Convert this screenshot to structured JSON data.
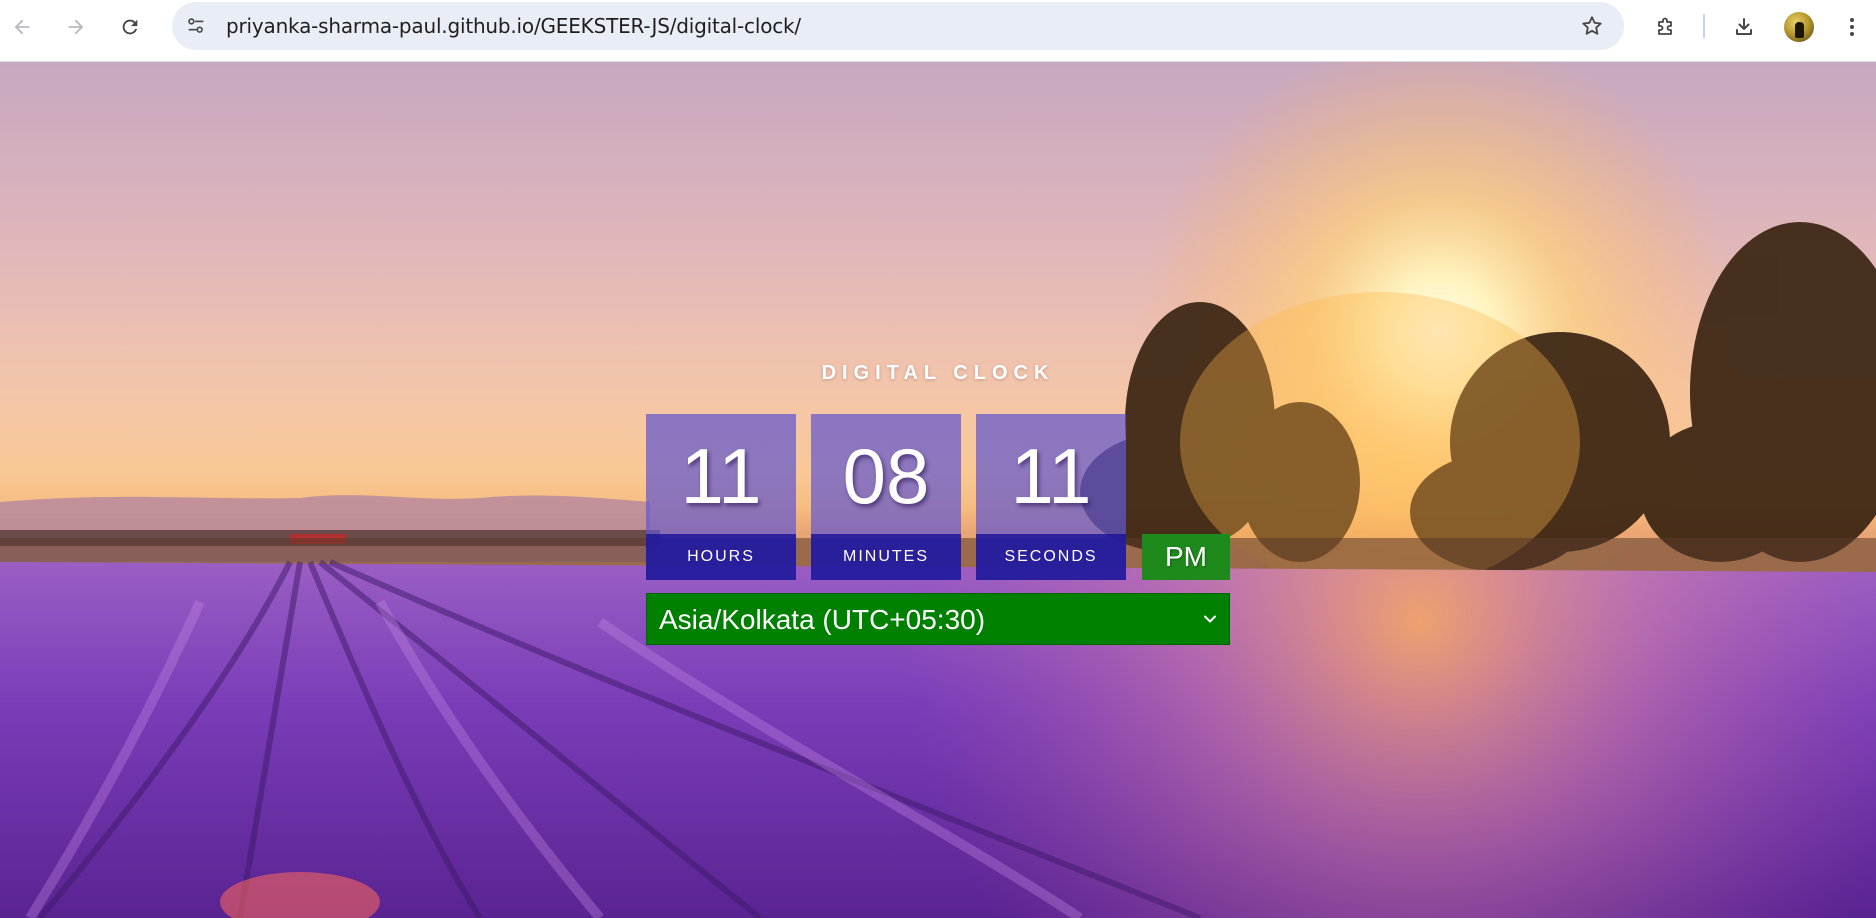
{
  "browser": {
    "url": "priyanka-sharma-paul.github.io/GEEKSTER-JS/digital-clock/",
    "icons": {
      "back": "arrow-left-icon",
      "forward": "arrow-right-icon",
      "reload": "reload-icon",
      "site_info": "tune-icon",
      "bookmark": "star-icon",
      "extensions": "puzzle-icon",
      "downloads": "download-icon",
      "menu": "kebab-menu-icon"
    }
  },
  "clock": {
    "title": "DIGITAL CLOCK",
    "hours": "11",
    "hours_label": "HOURS",
    "minutes": "08",
    "minutes_label": "MINUTES",
    "seconds": "11",
    "seconds_label": "SECONDS",
    "meridiem": "PM",
    "timezone": "Asia/Kolkata (UTC+05:30)"
  },
  "colors": {
    "box_fill": "#6458cd",
    "label_fill": "#1a1296",
    "meridiem_fill": "#1f8a1c",
    "timezone_fill": "#008000"
  }
}
